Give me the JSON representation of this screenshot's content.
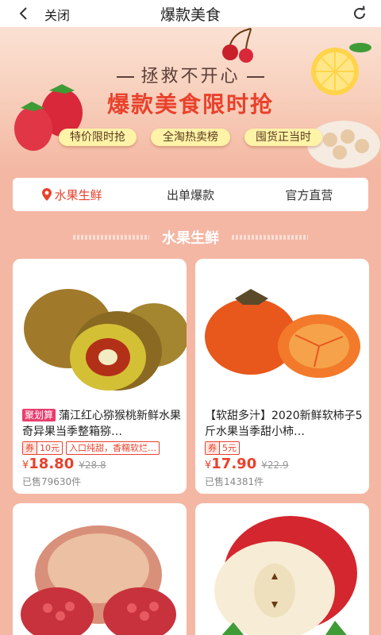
{
  "topbar": {
    "back_icon": "chevron-left-icon",
    "close_label": "关闭",
    "title": "爆款美食",
    "refresh_icon": "refresh-icon"
  },
  "banner": {
    "subtitle": "拯救不开心",
    "headline": "爆款美食限时抢",
    "pills": [
      "特价限时抢",
      "全淘热卖榜",
      "囤货正当时"
    ]
  },
  "tabs": [
    {
      "label": "水果生鲜",
      "active": true,
      "icon": "location-pin-icon"
    },
    {
      "label": "出单爆款",
      "active": false
    },
    {
      "label": "官方直营",
      "active": false
    }
  ],
  "section_title": "水果生鲜",
  "products": [
    {
      "tag": "聚划算",
      "name": "蒲江红心猕猴桃新鲜水果奇异果当季整箱猕…",
      "coupon_key": "券",
      "coupon_value": "10元",
      "benefit": "入口纯甜，香糯软烂…",
      "currency": "¥",
      "price": "18.80",
      "orig_price": "¥28.8",
      "sold": "已售79630件"
    },
    {
      "tag": "",
      "name": "【软甜多汁】2020新鲜软柿子5斤水果当季甜小柿…",
      "coupon_key": "券",
      "coupon_value": "5元",
      "benefit": "",
      "currency": "¥",
      "price": "17.90",
      "orig_price": "¥22.9",
      "sold": "已售14381件"
    },
    {
      "image": "pomegranate"
    },
    {
      "image": "apple"
    }
  ],
  "colors": {
    "accent": "#e9412c",
    "background": "#f4b7a4",
    "tag": "#e93d6e"
  }
}
